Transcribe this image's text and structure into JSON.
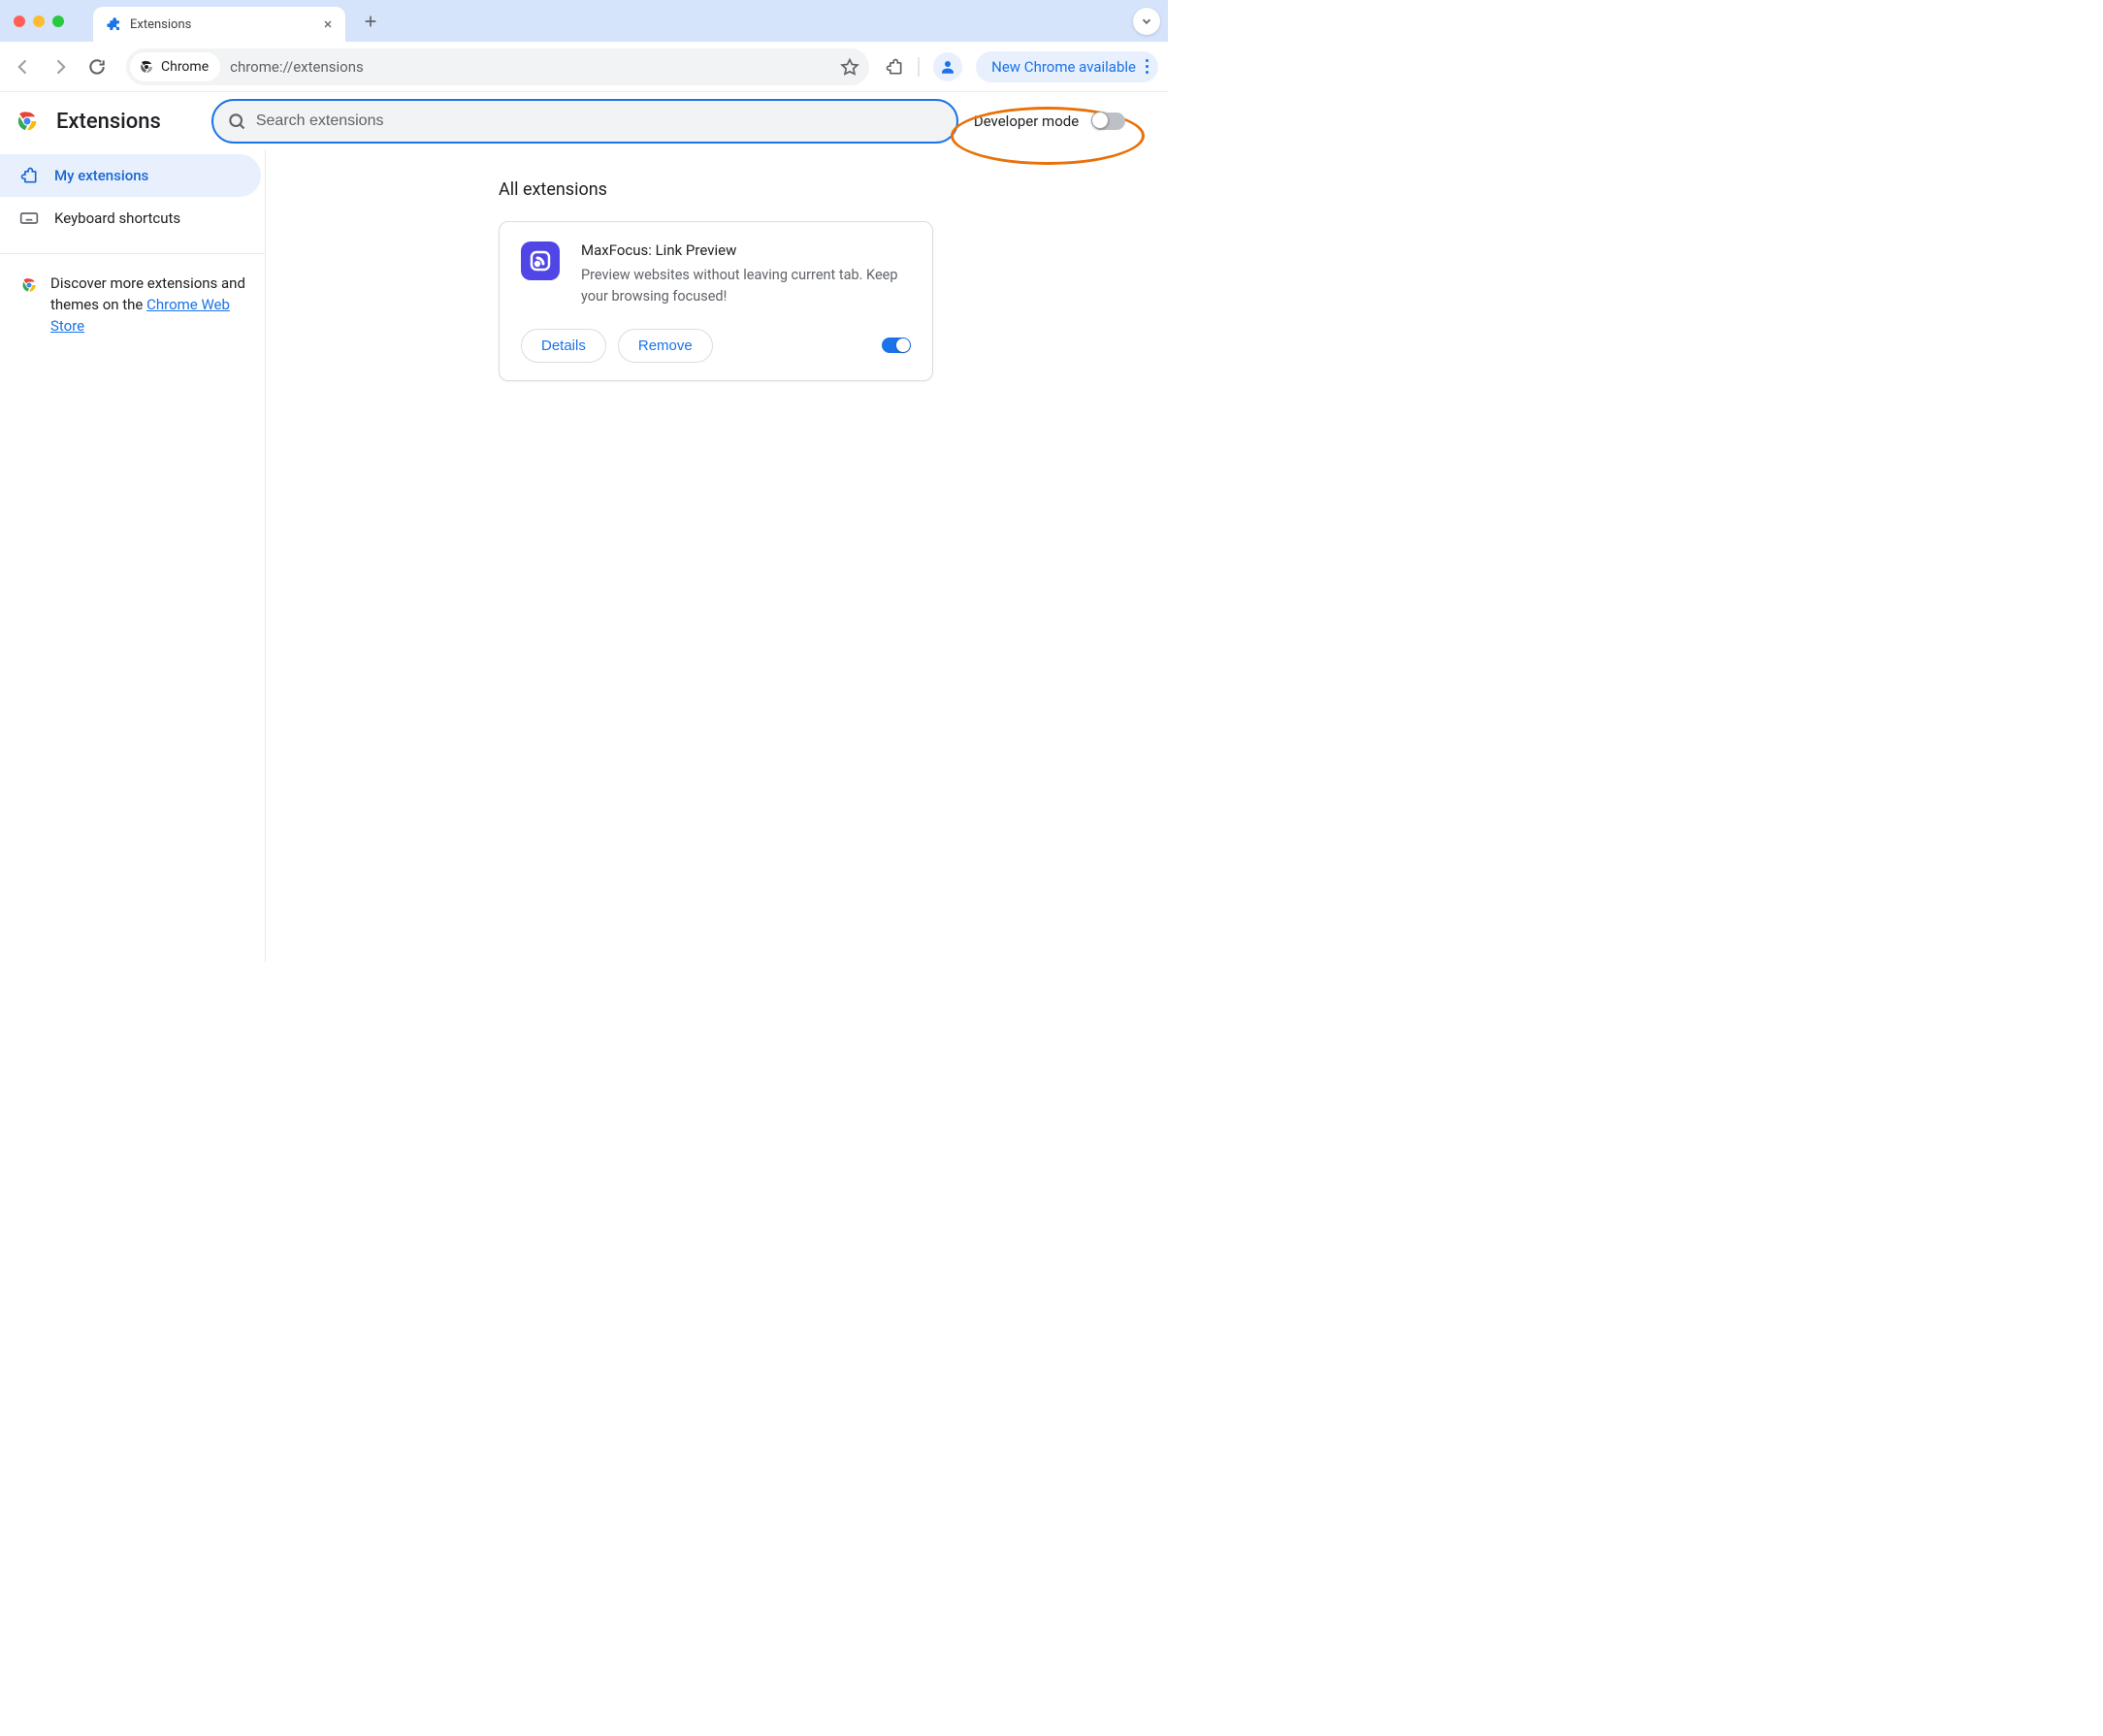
{
  "browser": {
    "tab_title": "Extensions",
    "site_chip_label": "Chrome",
    "url": "chrome://extensions",
    "update_label": "New Chrome available"
  },
  "header": {
    "page_title": "Extensions",
    "search_placeholder": "Search extensions",
    "dev_mode_label": "Developer mode",
    "dev_mode_on": false
  },
  "sidebar": {
    "items": [
      {
        "label": "My extensions",
        "active": true
      },
      {
        "label": "Keyboard shortcuts",
        "active": false
      }
    ],
    "promo_prefix": "Discover more extensions and themes on the ",
    "promo_link": "Chrome Web Store"
  },
  "content": {
    "section_title": "All extensions",
    "extensions": [
      {
        "name": "MaxFocus: Link Preview",
        "description": "Preview websites without leaving current tab. Keep your browsing focused!",
        "details_label": "Details",
        "remove_label": "Remove",
        "enabled": true
      }
    ]
  }
}
